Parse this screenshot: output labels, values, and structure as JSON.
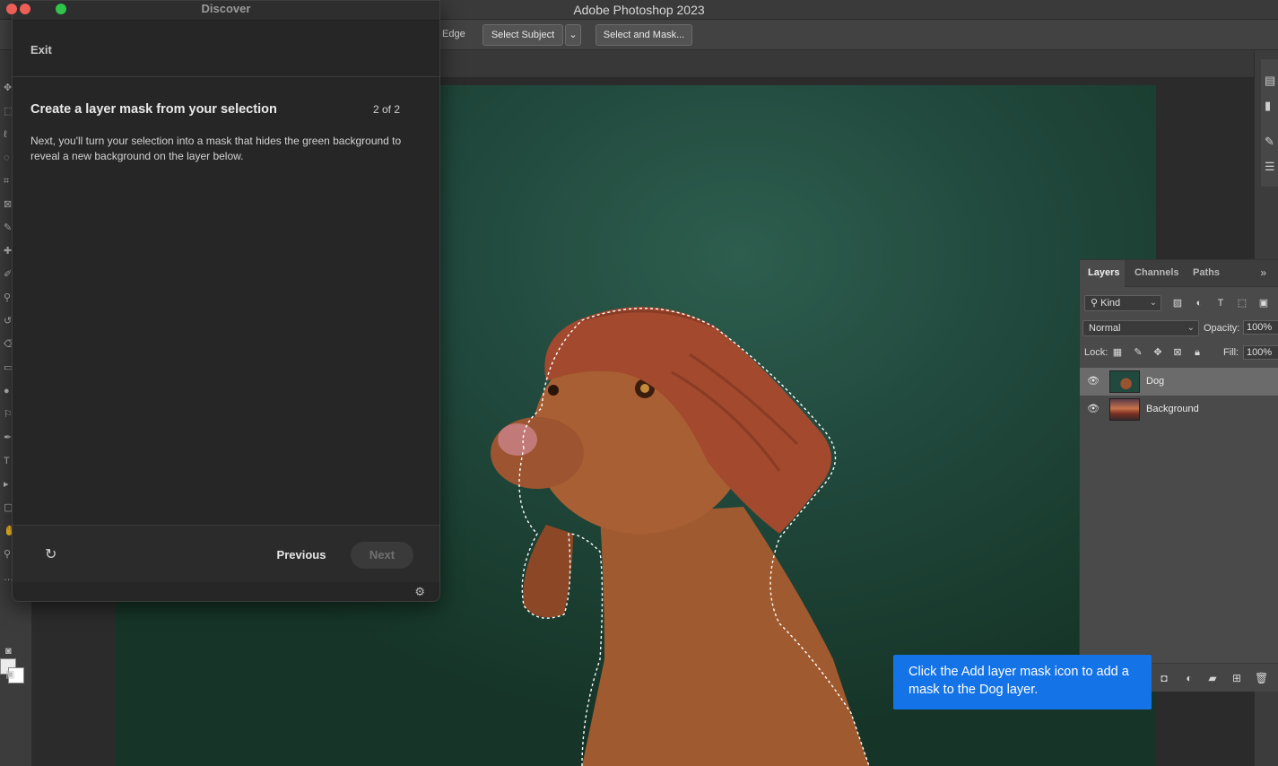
{
  "app": {
    "title": "Adobe Photoshop 2023"
  },
  "options_bar": {
    "edge_label": "Edge",
    "select_subject": "Select Subject",
    "select_and_mask": "Select and Mask..."
  },
  "discover": {
    "title": "Discover",
    "exit": "Exit",
    "step_title": "Create a layer mask from your selection",
    "step_count": "2 of 2",
    "step_description": "Next, you'll turn your selection into a mask that hides the green background to reveal a new background on the layer below.",
    "previous": "Previous",
    "next": "Next"
  },
  "layers_panel": {
    "tabs": [
      "Layers",
      "Channels",
      "Paths"
    ],
    "filter_kind": "Kind",
    "blend_mode": "Normal",
    "opacity_label": "Opacity:",
    "opacity_value": "100%",
    "lock_label": "Lock:",
    "fill_label": "Fill:",
    "fill_value": "100%",
    "layers": [
      {
        "name": "Dog",
        "visible": true,
        "selected": true
      },
      {
        "name": "Background",
        "visible": true,
        "selected": false
      }
    ]
  },
  "tooltip": {
    "text": "Click the Add layer mask icon to add a mask to the Dog layer."
  },
  "colors": {
    "accent": "#1473e6",
    "background_green": "#21493d"
  }
}
